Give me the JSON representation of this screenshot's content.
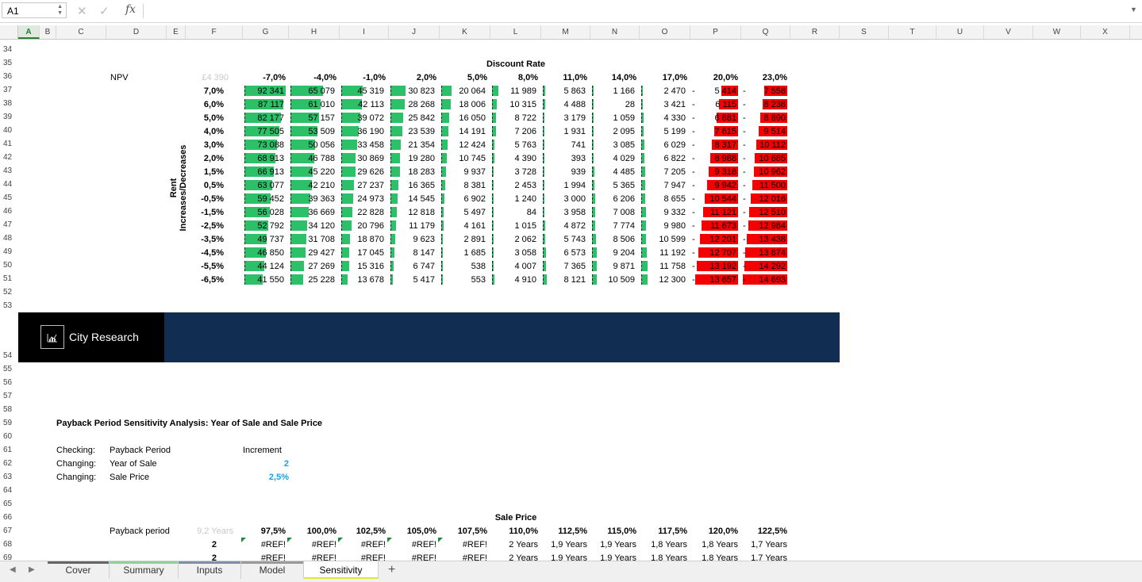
{
  "formula_bar": {
    "name_box": "A1",
    "fx": "fx",
    "content": ""
  },
  "columns": [
    "A",
    "B",
    "C",
    "D",
    "E",
    "F",
    "G",
    "H",
    "I",
    "J",
    "K",
    "L",
    "M",
    "N",
    "O",
    "P",
    "Q",
    "R",
    "S",
    "T",
    "U",
    "V",
    "W",
    "X"
  ],
  "rows_top": [
    "34",
    "35",
    "36",
    "37",
    "38",
    "39",
    "40",
    "41",
    "42",
    "43",
    "44",
    "45",
    "46",
    "47",
    "48",
    "49",
    "50",
    "51",
    "52",
    "53"
  ],
  "rows_bottom": [
    "54",
    "55",
    "56",
    "57",
    "58",
    "59",
    "60",
    "61",
    "62",
    "63",
    "64",
    "65",
    "66",
    "67",
    "68",
    "69"
  ],
  "npv_table": {
    "header_label": "Discount Rate",
    "corner_label": "NPV",
    "corner_value": "£4 390",
    "side_label": "Rent Increases/Decreases",
    "discount_rates": [
      "-7,0%",
      "-4,0%",
      "-1,0%",
      "2,0%",
      "5,0%",
      "8,0%",
      "11,0%",
      "14,0%",
      "17,0%",
      "20,0%",
      "23,0%"
    ],
    "rent_rates": [
      "7,0%",
      "6,0%",
      "5,0%",
      "4,0%",
      "3,0%",
      "2,0%",
      "1,5%",
      "0,5%",
      "-0,5%",
      "-1,5%",
      "-2,5%",
      "-3,5%",
      "-4,5%",
      "-5,5%",
      "-6,5%"
    ],
    "values": [
      [
        "92 341",
        "65 079",
        "45 319",
        "30 823",
        "20 064",
        "11 989",
        "5 863",
        "1 166",
        "2 470",
        "5 414",
        "7 558"
      ],
      [
        "87 117",
        "61 010",
        "42 113",
        "28 268",
        "18 006",
        "10 315",
        "4 488",
        "28",
        "3 421",
        "6 115",
        "8 238"
      ],
      [
        "82 177",
        "57 157",
        "39 072",
        "25 842",
        "16 050",
        "8 722",
        "3 179",
        "1 059",
        "4 330",
        "6 881",
        "8 890"
      ],
      [
        "77 505",
        "53 509",
        "36 190",
        "23 539",
        "14 191",
        "7 206",
        "1 931",
        "2 095",
        "5 199",
        "7 615",
        "9 514"
      ],
      [
        "73 088",
        "50 056",
        "33 458",
        "21 354",
        "12 424",
        "5 763",
        "741",
        "3 085",
        "6 029",
        "8 317",
        "10 112"
      ],
      [
        "68 913",
        "46 788",
        "30 869",
        "19 280",
        "10 745",
        "4 390",
        "393",
        "4 029",
        "6 822",
        "8 988",
        "10 685"
      ],
      [
        "66 913",
        "45 220",
        "29 626",
        "18 283",
        "9 937",
        "3 728",
        "939",
        "4 485",
        "7 205",
        "9 318",
        "10 962"
      ],
      [
        "63 077",
        "42 210",
        "27 237",
        "16 365",
        "8 381",
        "2 453",
        "1 994",
        "5 365",
        "7 947",
        "9 942",
        "11 500"
      ],
      [
        "59 452",
        "39 363",
        "24 973",
        "14 545",
        "6 902",
        "1 240",
        "3 000",
        "6 206",
        "8 655",
        "10 544",
        "12 016"
      ],
      [
        "56 028",
        "36 669",
        "22 828",
        "12 818",
        "5 497",
        "84",
        "3 958",
        "7 008",
        "9 332",
        "11 121",
        "12 510"
      ],
      [
        "52 792",
        "34 120",
        "20 796",
        "11 179",
        "4 161",
        "1 015",
        "4 872",
        "7 774",
        "9 980",
        "11 673",
        "12 984"
      ],
      [
        "49 737",
        "31 708",
        "18 870",
        "9 623",
        "2 891",
        "2 062",
        "5 743",
        "8 506",
        "10 599",
        "12 201",
        "13 438"
      ],
      [
        "46 850",
        "29 427",
        "17 045",
        "8 147",
        "1 685",
        "3 058",
        "6 573",
        "9 204",
        "11 192",
        "12 707",
        "13 874"
      ],
      [
        "44 124",
        "27 269",
        "15 316",
        "6 747",
        "538",
        "4 007",
        "7 365",
        "9 871",
        "11 758",
        "13 192",
        "14 292"
      ],
      [
        "41 550",
        "25 228",
        "13 678",
        "5 417",
        "553",
        "4 910",
        "8 121",
        "10 509",
        "12 300",
        "13 657",
        "14 693"
      ]
    ],
    "bar_fraction": [
      [
        1.0,
        0.71,
        0.49,
        0.33,
        0.22,
        0.13,
        0.06,
        0.01,
        0.03,
        0.37,
        0.52
      ],
      [
        0.94,
        0.66,
        0.46,
        0.31,
        0.2,
        0.11,
        0.05,
        0.0,
        0.04,
        0.42,
        0.56
      ],
      [
        0.89,
        0.62,
        0.42,
        0.28,
        0.17,
        0.09,
        0.03,
        0.01,
        0.05,
        0.47,
        0.61
      ],
      [
        0.84,
        0.58,
        0.39,
        0.25,
        0.15,
        0.08,
        0.02,
        0.02,
        0.06,
        0.52,
        0.65
      ],
      [
        0.79,
        0.54,
        0.36,
        0.23,
        0.13,
        0.06,
        0.01,
        0.03,
        0.07,
        0.57,
        0.69
      ],
      [
        0.75,
        0.51,
        0.33,
        0.21,
        0.12,
        0.05,
        0.0,
        0.04,
        0.07,
        0.61,
        0.73
      ],
      [
        0.72,
        0.49,
        0.32,
        0.2,
        0.11,
        0.04,
        0.01,
        0.05,
        0.08,
        0.63,
        0.75
      ],
      [
        0.68,
        0.46,
        0.29,
        0.18,
        0.09,
        0.03,
        0.02,
        0.06,
        0.09,
        0.68,
        0.78
      ],
      [
        0.64,
        0.43,
        0.27,
        0.16,
        0.07,
        0.01,
        0.03,
        0.07,
        0.09,
        0.72,
        0.82
      ],
      [
        0.61,
        0.4,
        0.25,
        0.14,
        0.06,
        0.0,
        0.04,
        0.08,
        0.1,
        0.76,
        0.85
      ],
      [
        0.57,
        0.37,
        0.23,
        0.12,
        0.05,
        0.01,
        0.05,
        0.08,
        0.11,
        0.79,
        0.88
      ],
      [
        0.54,
        0.34,
        0.2,
        0.1,
        0.03,
        0.02,
        0.06,
        0.09,
        0.11,
        0.83,
        0.91
      ],
      [
        0.51,
        0.32,
        0.18,
        0.09,
        0.02,
        0.03,
        0.07,
        0.1,
        0.12,
        0.86,
        0.94
      ],
      [
        0.48,
        0.3,
        0.17,
        0.07,
        0.01,
        0.04,
        0.08,
        0.11,
        0.13,
        0.9,
        0.97
      ],
      [
        0.45,
        0.27,
        0.15,
        0.06,
        0.01,
        0.05,
        0.09,
        0.11,
        0.13,
        0.93,
        1.0
      ]
    ],
    "negative_marker": "-",
    "positive_color": "#2cc069",
    "negative_color": "#f40000"
  },
  "banner": {
    "logo_text": "City Research",
    "left_color": "#000000",
    "right_color": "#122d52"
  },
  "payback": {
    "title": "Payback Period Sensitivity Analysis: Year of Sale and Sale Price",
    "checking_label": "Checking:",
    "checking_value": "Payback Period",
    "changing1_label": "Changing:",
    "changing1_value": "Year of Sale",
    "changing2_label": "Changing:",
    "changing2_value": "Sale Price",
    "increment_label": "Increment",
    "increment_year": "2",
    "increment_price": "2,5%",
    "header_label": "Sale Price",
    "corner_label": "Payback period",
    "corner_value": "9,2 Years",
    "sale_prices": [
      "97,5%",
      "100,0%",
      "102,5%",
      "105,0%",
      "107,5%",
      "110,0%",
      "112,5%",
      "115,0%",
      "117,5%",
      "120,0%",
      "122,5%"
    ],
    "rows": [
      {
        "year": "2",
        "values": [
          "#REF!",
          "#REF!",
          "#REF!",
          "#REF!",
          "#REF!",
          "2 Years",
          "1,9 Years",
          "1,9 Years",
          "1,8 Years",
          "1,8 Years",
          "1,7 Years"
        ]
      },
      {
        "year": "2",
        "values": [
          "#REF!",
          "#REF!",
          "#REF!",
          "#REF!",
          "#REF!",
          "2 Years",
          "1,9 Years",
          "1,9 Years",
          "1,8 Years",
          "1,8 Years",
          "1,7 Years"
        ]
      }
    ]
  },
  "sheet_tabs": [
    {
      "label": "Cover",
      "color": "#666666"
    },
    {
      "label": "Summary",
      "color": "#8fd19e"
    },
    {
      "label": "Inputs",
      "color": "#7e8fa6"
    },
    {
      "label": "Model",
      "color": "#999999"
    },
    {
      "label": "Sensitivity",
      "color": "#e6e632",
      "active": true
    }
  ],
  "add_sheet_label": "+"
}
